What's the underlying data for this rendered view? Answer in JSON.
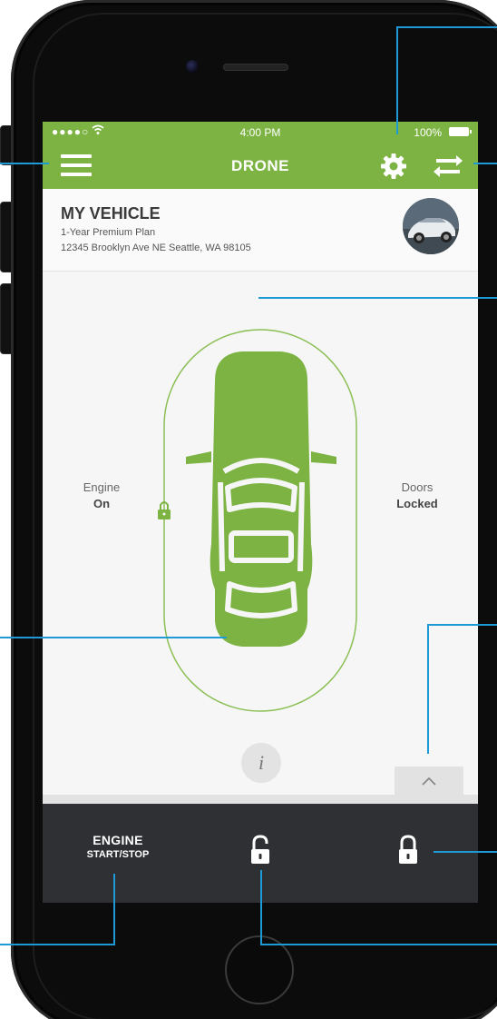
{
  "status_bar": {
    "signal": "●●●●○",
    "time": "4:00 PM",
    "battery": "100%"
  },
  "nav": {
    "title": "DRONE",
    "menu_icon": "hamburger-menu-icon",
    "settings_icon": "gear-icon",
    "switch_icon": "swap-arrows-icon"
  },
  "vehicle": {
    "name": "MY VEHICLE",
    "plan": "1-Year Premium Plan",
    "address": "12345 Brooklyn Ave NE Seattle, WA 98105",
    "avatar_icon": "car-photo-avatar"
  },
  "status": {
    "engine_label": "Engine",
    "engine_value": "On",
    "doors_label": "Doors",
    "doors_value": "Locked"
  },
  "info_button": {
    "label": "i"
  },
  "bottom_bar": {
    "engine_line1": "ENGINE",
    "engine_line2": "START/STOP",
    "unlock_icon": "unlock-icon",
    "lock_icon": "lock-icon"
  },
  "colors": {
    "accent_green": "#7cb342",
    "bottom_bar": "#2e3033",
    "callout_blue": "#1e9bd7"
  }
}
